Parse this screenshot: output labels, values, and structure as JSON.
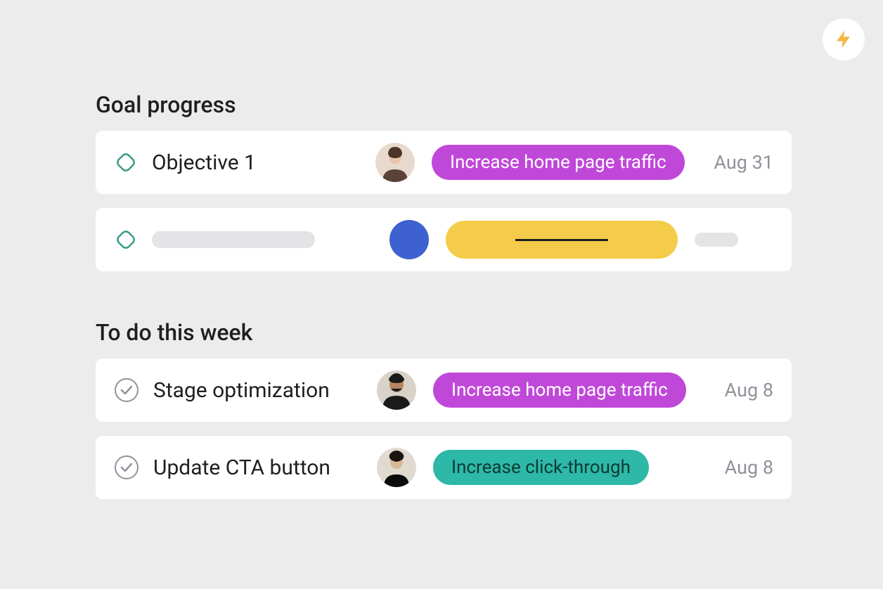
{
  "lightning_icon": "lightning-icon",
  "colors": {
    "purple_pill": "#c048d9",
    "teal_pill": "#2db8a8",
    "yellow_pill": "#f4cc49",
    "blue_circle": "#3e61d0",
    "goal_outline": "#3a9c88"
  },
  "sections": {
    "goal_progress": {
      "title": "Goal progress",
      "items": [
        {
          "title": "Objective 1",
          "tag_label": "Increase home page traffic",
          "tag_color": "purple",
          "date": "Aug 31"
        }
      ]
    },
    "todo": {
      "title": "To do this week",
      "items": [
        {
          "title": "Stage optimization",
          "tag_label": "Increase home page traffic",
          "tag_color": "purple",
          "date": "Aug 8"
        },
        {
          "title": "Update CTA button",
          "tag_label": "Increase click-through",
          "tag_color": "teal",
          "date": "Aug 8"
        }
      ]
    }
  }
}
